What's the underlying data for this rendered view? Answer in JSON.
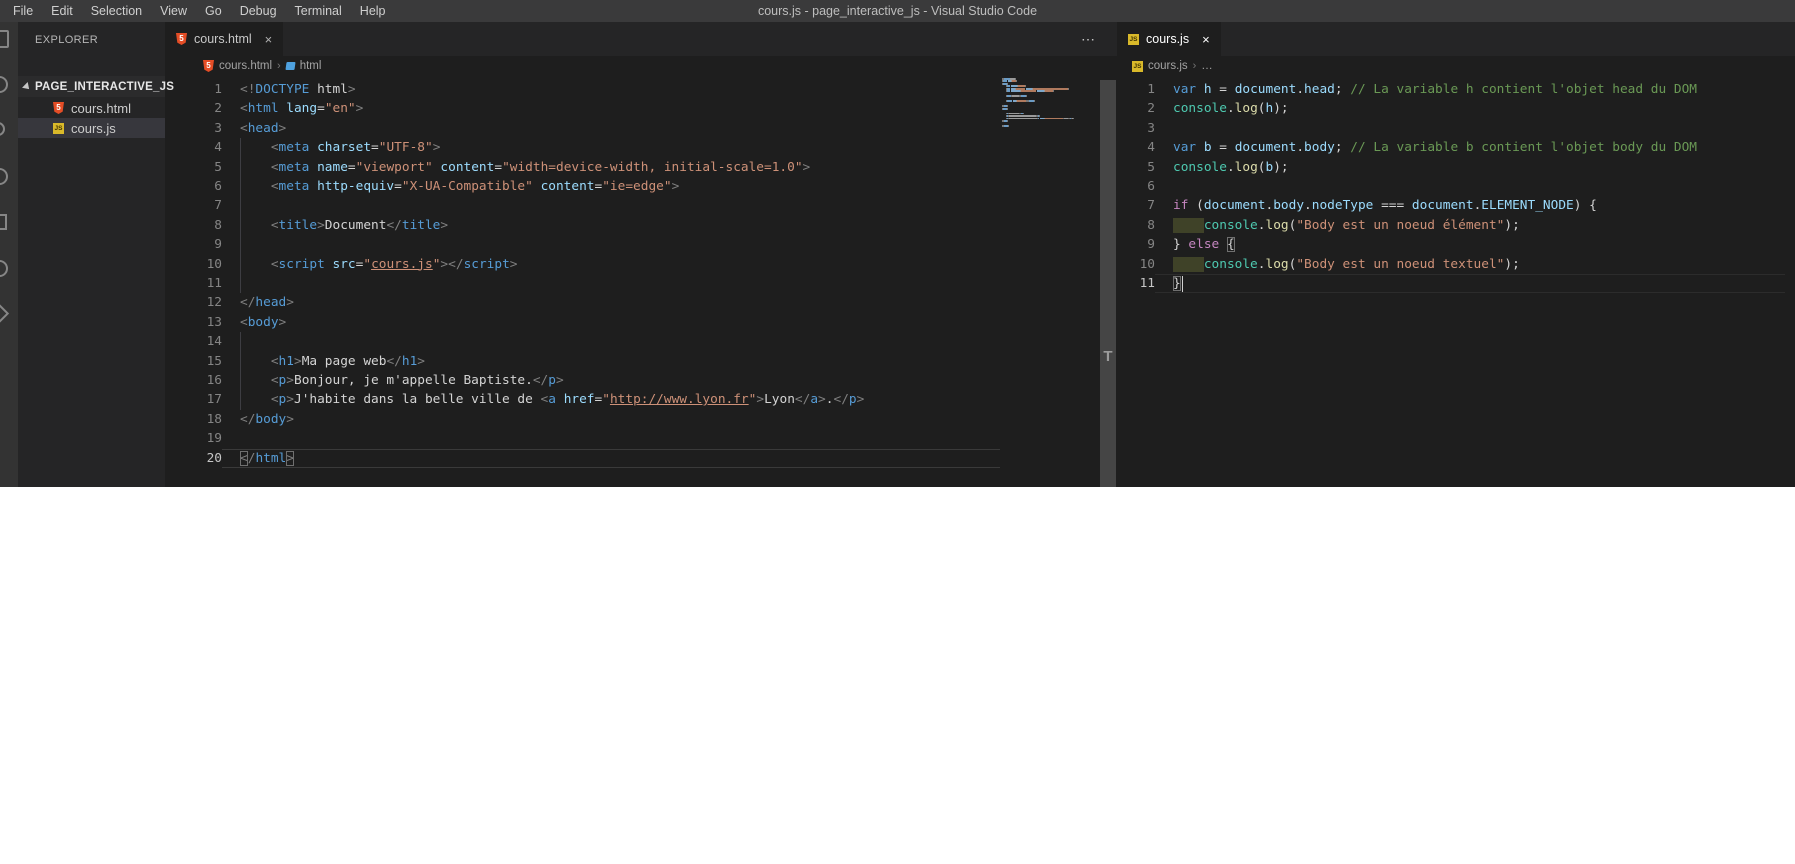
{
  "window_title": "cours.js - page_interactive_js - Visual Studio Code",
  "menu": [
    "File",
    "Edit",
    "Selection",
    "View",
    "Go",
    "Debug",
    "Terminal",
    "Help"
  ],
  "activity_bar_icons": [
    "explorer",
    "search",
    "source-control",
    "debug",
    "extensions",
    "account",
    "settings"
  ],
  "explorer": {
    "header": "EXPLORER",
    "folder": "PAGE_INTERACTIVE_JS",
    "files": [
      {
        "name": "cours.html",
        "icon": "html",
        "selected": false
      },
      {
        "name": "cours.js",
        "icon": "js",
        "selected": true
      }
    ]
  },
  "colors": {
    "editor_bg": "#1e1e1e",
    "sidebar_bg": "#252526",
    "titlebar_bg": "#3a3a3b",
    "html_icon": "#e44d26",
    "js_icon": "#d9b92a",
    "string": "#ce9178",
    "tag": "#569cd6",
    "comment": "#6a9955",
    "selection_row": "#37373d"
  },
  "sash_label": "T",
  "left_editor": {
    "tab": {
      "label": "cours.html",
      "close": "×"
    },
    "actions_label": "⋯",
    "breadcrumb": {
      "file": "cours.html",
      "separator": "›",
      "symbol": "html"
    },
    "active_line": 20,
    "lines": [
      {
        "guide": false,
        "tokens": [
          [
            "punct",
            "<!"
          ],
          [
            "tag",
            "DOCTYPE"
          ],
          [
            "plain",
            " html"
          ],
          [
            "punct",
            ">"
          ]
        ]
      },
      {
        "guide": false,
        "tokens": [
          [
            "punct",
            "<"
          ],
          [
            "tag",
            "html"
          ],
          [
            "plain",
            " "
          ],
          [
            "attr",
            "lang"
          ],
          [
            "plain",
            "="
          ],
          [
            "str",
            "\"en\""
          ],
          [
            "punct",
            ">"
          ]
        ]
      },
      {
        "guide": false,
        "tokens": [
          [
            "punct",
            "<"
          ],
          [
            "tag",
            "head"
          ],
          [
            "punct",
            ">"
          ]
        ]
      },
      {
        "guide": true,
        "tokens": [
          [
            "plain",
            "    "
          ],
          [
            "punct",
            "<"
          ],
          [
            "tag",
            "meta"
          ],
          [
            "plain",
            " "
          ],
          [
            "attr",
            "charset"
          ],
          [
            "plain",
            "="
          ],
          [
            "str",
            "\"UTF-8\""
          ],
          [
            "punct",
            ">"
          ]
        ]
      },
      {
        "guide": true,
        "tokens": [
          [
            "plain",
            "    "
          ],
          [
            "punct",
            "<"
          ],
          [
            "tag",
            "meta"
          ],
          [
            "plain",
            " "
          ],
          [
            "attr",
            "name"
          ],
          [
            "plain",
            "="
          ],
          [
            "str",
            "\"viewport\""
          ],
          [
            "plain",
            " "
          ],
          [
            "attr",
            "content"
          ],
          [
            "plain",
            "="
          ],
          [
            "str",
            "\"width=device-width, initial-scale=1.0\""
          ],
          [
            "punct",
            ">"
          ]
        ]
      },
      {
        "guide": true,
        "tokens": [
          [
            "plain",
            "    "
          ],
          [
            "punct",
            "<"
          ],
          [
            "tag",
            "meta"
          ],
          [
            "plain",
            " "
          ],
          [
            "attr",
            "http-equiv"
          ],
          [
            "plain",
            "="
          ],
          [
            "str",
            "\"X-UA-Compatible\""
          ],
          [
            "plain",
            " "
          ],
          [
            "attr",
            "content"
          ],
          [
            "plain",
            "="
          ],
          [
            "str",
            "\"ie=edge\""
          ],
          [
            "punct",
            ">"
          ]
        ]
      },
      {
        "guide": true,
        "tokens": []
      },
      {
        "guide": true,
        "tokens": [
          [
            "plain",
            "    "
          ],
          [
            "punct",
            "<"
          ],
          [
            "tag",
            "title"
          ],
          [
            "punct",
            ">"
          ],
          [
            "plain",
            "Document"
          ],
          [
            "punct",
            "</"
          ],
          [
            "tag",
            "title"
          ],
          [
            "punct",
            ">"
          ]
        ]
      },
      {
        "guide": true,
        "tokens": []
      },
      {
        "guide": true,
        "tokens": [
          [
            "plain",
            "    "
          ],
          [
            "punct",
            "<"
          ],
          [
            "tag",
            "script"
          ],
          [
            "plain",
            " "
          ],
          [
            "attr",
            "src"
          ],
          [
            "plain",
            "="
          ],
          [
            "str",
            "\""
          ],
          [
            "strU",
            "cours.js"
          ],
          [
            "str",
            "\""
          ],
          [
            "punct",
            ">"
          ],
          [
            "punct",
            "</"
          ],
          [
            "tag",
            "script"
          ],
          [
            "punct",
            ">"
          ]
        ]
      },
      {
        "guide": true,
        "tokens": []
      },
      {
        "guide": false,
        "tokens": [
          [
            "punct",
            "</"
          ],
          [
            "tag",
            "head"
          ],
          [
            "punct",
            ">"
          ]
        ]
      },
      {
        "guide": false,
        "tokens": [
          [
            "punct",
            "<"
          ],
          [
            "tag",
            "body"
          ],
          [
            "punct",
            ">"
          ]
        ]
      },
      {
        "guide": true,
        "tokens": []
      },
      {
        "guide": true,
        "tokens": [
          [
            "plain",
            "    "
          ],
          [
            "punct",
            "<"
          ],
          [
            "tag",
            "h1"
          ],
          [
            "punct",
            ">"
          ],
          [
            "plain",
            "Ma page web"
          ],
          [
            "punct",
            "</"
          ],
          [
            "tag",
            "h1"
          ],
          [
            "punct",
            ">"
          ]
        ]
      },
      {
        "guide": true,
        "tokens": [
          [
            "plain",
            "    "
          ],
          [
            "punct",
            "<"
          ],
          [
            "tag",
            "p"
          ],
          [
            "punct",
            ">"
          ],
          [
            "plain",
            "Bonjour, je m'appelle Baptiste."
          ],
          [
            "punct",
            "</"
          ],
          [
            "tag",
            "p"
          ],
          [
            "punct",
            ">"
          ]
        ]
      },
      {
        "guide": true,
        "tokens": [
          [
            "plain",
            "    "
          ],
          [
            "punct",
            "<"
          ],
          [
            "tag",
            "p"
          ],
          [
            "punct",
            ">"
          ],
          [
            "plain",
            "J'habite dans la belle ville de "
          ],
          [
            "punct",
            "<"
          ],
          [
            "tag",
            "a"
          ],
          [
            "plain",
            " "
          ],
          [
            "attr",
            "href"
          ],
          [
            "plain",
            "="
          ],
          [
            "str",
            "\""
          ],
          [
            "strU",
            "http://www.lyon.fr"
          ],
          [
            "str",
            "\""
          ],
          [
            "punct",
            ">"
          ],
          [
            "plain",
            "Lyon"
          ],
          [
            "punct",
            "</"
          ],
          [
            "tag",
            "a"
          ],
          [
            "punct",
            ">"
          ],
          [
            "plain",
            "."
          ],
          [
            "punct",
            "</"
          ],
          [
            "tag",
            "p"
          ],
          [
            "punct",
            ">"
          ]
        ]
      },
      {
        "guide": false,
        "tokens": [
          [
            "punct",
            "</"
          ],
          [
            "tag",
            "body"
          ],
          [
            "punct",
            ">"
          ]
        ]
      },
      {
        "guide": false,
        "tokens": []
      },
      {
        "guide": false,
        "tokens": [
          [
            "boxp",
            "<"
          ],
          [
            "punct",
            "/"
          ],
          [
            "tag",
            "html"
          ],
          [
            "boxp",
            ">"
          ]
        ]
      }
    ]
  },
  "right_editor": {
    "tab": {
      "label": "cours.js",
      "close": "×"
    },
    "breadcrumb": {
      "file": "cours.js",
      "separator": "›",
      "symbol": "…"
    },
    "active_line": 11,
    "cursor": {
      "line": 11,
      "col": 1
    },
    "lines": [
      {
        "tokens": [
          [
            "kw",
            "var"
          ],
          [
            "plain",
            " "
          ],
          [
            "var",
            "h"
          ],
          [
            "plain",
            " = "
          ],
          [
            "var",
            "document"
          ],
          [
            "plain",
            "."
          ],
          [
            "var",
            "head"
          ],
          [
            "plain",
            "; "
          ],
          [
            "cmt",
            "// La variable h contient l'objet head du DOM"
          ]
        ]
      },
      {
        "tokens": [
          [
            "cls",
            "console"
          ],
          [
            "plain",
            "."
          ],
          [
            "fn",
            "log"
          ],
          [
            "plain",
            "("
          ],
          [
            "var",
            "h"
          ],
          [
            "plain",
            ");"
          ]
        ]
      },
      {
        "tokens": []
      },
      {
        "tokens": [
          [
            "kw",
            "var"
          ],
          [
            "plain",
            " "
          ],
          [
            "var",
            "b"
          ],
          [
            "plain",
            " = "
          ],
          [
            "var",
            "document"
          ],
          [
            "plain",
            "."
          ],
          [
            "var",
            "body"
          ],
          [
            "plain",
            "; "
          ],
          [
            "cmt",
            "// La variable b contient l'objet body du DOM"
          ]
        ]
      },
      {
        "tokens": [
          [
            "cls",
            "console"
          ],
          [
            "plain",
            "."
          ],
          [
            "fn",
            "log"
          ],
          [
            "plain",
            "("
          ],
          [
            "var",
            "b"
          ],
          [
            "plain",
            ");"
          ]
        ]
      },
      {
        "tokens": []
      },
      {
        "tokens": [
          [
            "ctrl",
            "if"
          ],
          [
            "plain",
            " ("
          ],
          [
            "var",
            "document"
          ],
          [
            "plain",
            "."
          ],
          [
            "var",
            "body"
          ],
          [
            "plain",
            "."
          ],
          [
            "var",
            "nodeType"
          ],
          [
            "plain",
            " === "
          ],
          [
            "var",
            "document"
          ],
          [
            "plain",
            "."
          ],
          [
            "var",
            "ELEMENT_NODE"
          ],
          [
            "plain",
            ") {"
          ]
        ]
      },
      {
        "tokens": [
          [
            "iblock",
            "    "
          ],
          [
            "cls",
            "console"
          ],
          [
            "plain",
            "."
          ],
          [
            "fn",
            "log"
          ],
          [
            "plain",
            "("
          ],
          [
            "str",
            "\"Body est un noeud élément\""
          ],
          [
            "plain",
            ");"
          ]
        ]
      },
      {
        "tokens": [
          [
            "plain",
            "} "
          ],
          [
            "ctrl",
            "else"
          ],
          [
            "plain",
            " "
          ],
          [
            "boxw",
            "{"
          ]
        ]
      },
      {
        "tokens": [
          [
            "iblock",
            "    "
          ],
          [
            "cls",
            "console"
          ],
          [
            "plain",
            "."
          ],
          [
            "fn",
            "log"
          ],
          [
            "plain",
            "("
          ],
          [
            "str",
            "\"Body est un noeud textuel\""
          ],
          [
            "plain",
            ");"
          ]
        ]
      },
      {
        "tokens": [
          [
            "boxw",
            "}"
          ]
        ]
      }
    ]
  }
}
